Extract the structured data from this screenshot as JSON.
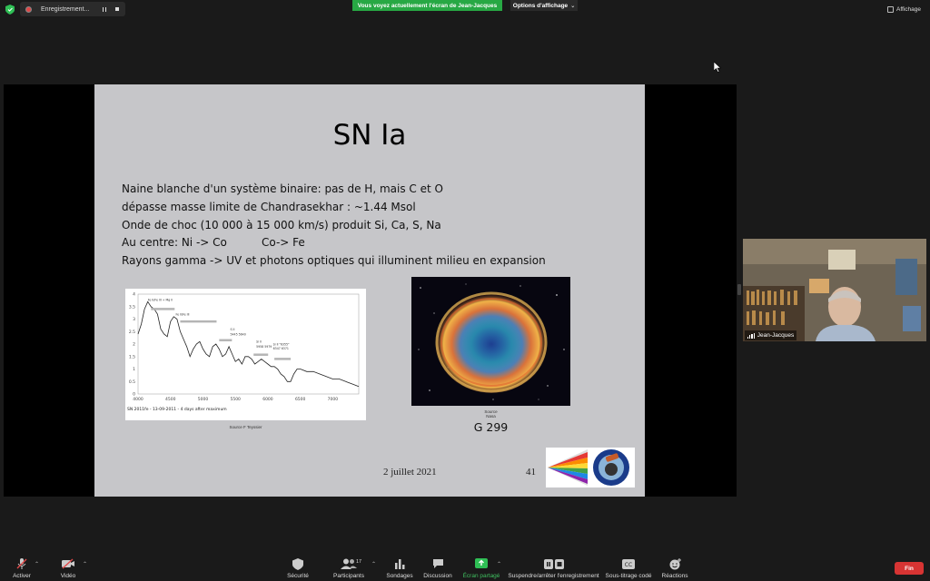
{
  "topbar": {
    "recording_label": "Enregistrement...",
    "share_banner": "Vous voyez actuellement l'écran de Jean-Jacques",
    "view_options": "Options d'affichage",
    "affichage": "Affichage"
  },
  "slide": {
    "title": "SN Ia",
    "bullets": [
      "Naine blanche d'un système binaire: pas de H, mais C et O",
      "dépasse masse limite de Chandrasekhar : ~1.44 Msol",
      "Onde de choc (10 000 à 15 000 km/s) produit Si, Ca, S, Na",
      "Au centre: Ni -> Co          Co-> Fe",
      "Rayons gamma -> UV et photons optiques qui illuminent milieu en expansion"
    ],
    "spectrum": {
      "caption_object": "SN 2011fe - 13-09-2011 - 4 days after maximum",
      "source": "Source  F  Teyssier",
      "y_ticks": [
        "4",
        "3.5",
        "3",
        "2.5",
        "2",
        "1.5",
        "1",
        "0.5",
        "0"
      ],
      "x_ticks": [
        "4000",
        "4500",
        "5000",
        "5500",
        "6000",
        "6500",
        "7000"
      ],
      "line_labels": [
        "Fe II/Fe III + Mg II",
        "Fe II/Fe III",
        "S II",
        "5445 5640",
        "Si II",
        "5958 5979",
        "Si II \"6355\"",
        "6347 6371"
      ]
    },
    "image_caption_1": "Source",
    "image_caption_2": "Nasa",
    "image_name": "G 299",
    "date": "2 juillet 2021",
    "page_number": "41",
    "logo_text_top": "CLUB D'ASTRONOMIE",
    "logo_text_bottom": "DE NANTES"
  },
  "participant": {
    "name": "Jean-Jacques"
  },
  "toolbar": {
    "mute": "Activer",
    "video": "Vidéo",
    "security": "Sécurité",
    "participants": "Participants",
    "participants_count": "17",
    "polls": "Sondages",
    "chat": "Discussion",
    "share": "Écran partagé",
    "record": "Suspendre/arrêter l'enregistrement",
    "captions": "Sous-titrage codé",
    "reactions": "Réactions",
    "end": "Fin"
  },
  "colors": {
    "share_banner": "#27a844",
    "end_button": "#d73433",
    "slide_bg": "#c6c6c9",
    "record_dot": "#e04848"
  },
  "chart_data": {
    "type": "line",
    "xlabel": "",
    "ylabel": "",
    "xlim": [
      4000,
      7400
    ],
    "ylim": [
      0,
      4
    ],
    "x": [
      4000,
      4050,
      4100,
      4150,
      4200,
      4250,
      4300,
      4350,
      4400,
      4450,
      4500,
      4550,
      4600,
      4650,
      4700,
      4750,
      4800,
      4850,
      4900,
      4950,
      5000,
      5050,
      5100,
      5150,
      5200,
      5250,
      5300,
      5350,
      5400,
      5450,
      5500,
      5550,
      5600,
      5650,
      5700,
      5750,
      5800,
      5850,
      5900,
      5950,
      6000,
      6050,
      6100,
      6150,
      6200,
      6250,
      6300,
      6350,
      6400,
      6450,
      6500,
      6600,
      6700,
      6800,
      6900,
      7000,
      7100,
      7200,
      7300,
      7400
    ],
    "y": [
      2.4,
      2.8,
      3.4,
      3.7,
      3.5,
      3.4,
      3.2,
      2.6,
      2.4,
      2.3,
      2.9,
      3.1,
      3.0,
      2.5,
      2.2,
      1.9,
      1.5,
      1.8,
      2.0,
      2.1,
      1.8,
      1.6,
      1.5,
      1.9,
      2.0,
      1.8,
      1.5,
      1.6,
      1.9,
      1.6,
      1.3,
      1.4,
      1.2,
      1.5,
      1.5,
      1.4,
      1.2,
      1.3,
      1.4,
      1.3,
      1.2,
      1.1,
      1.1,
      1.0,
      0.8,
      0.7,
      0.5,
      0.5,
      0.8,
      1.0,
      1.0,
      0.9,
      0.9,
      0.8,
      0.7,
      0.6,
      0.6,
      0.5,
      0.4,
      0.3
    ]
  }
}
